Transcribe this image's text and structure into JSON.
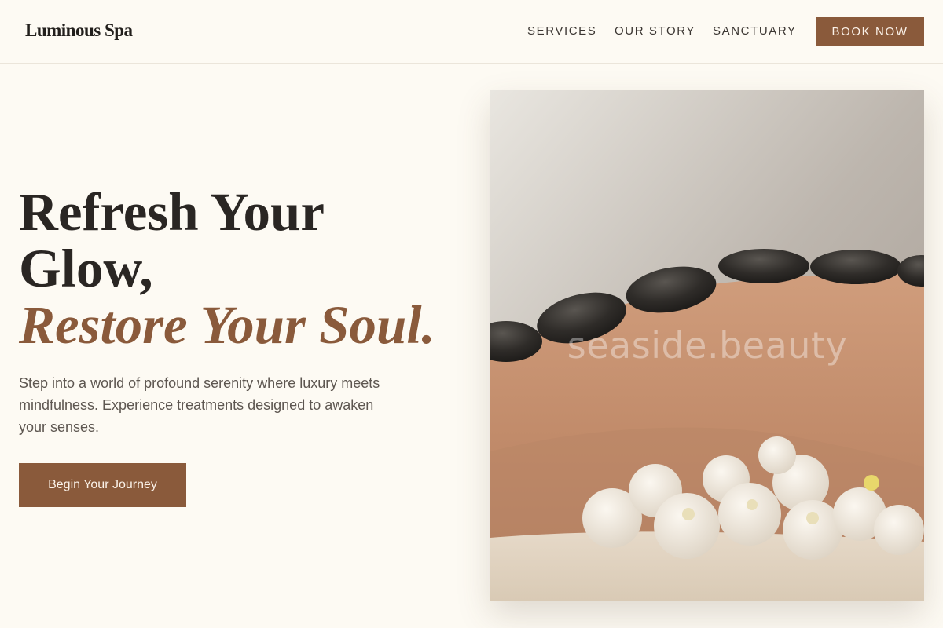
{
  "brand": {
    "name": "Luminous Spa"
  },
  "nav": {
    "items": [
      "SERVICES",
      "OUR STORY",
      "SANCTUARY"
    ],
    "cta_label": "BOOK NOW"
  },
  "hero": {
    "headline_line1": "Refresh Your",
    "headline_line2": "Glow,",
    "headline_accent": "Restore Your Soul.",
    "subtext": "Step into a world of profound serenity where luxury meets mindfulness. Experience treatments designed to awaken your senses.",
    "cta_label": "Begin Your Journey",
    "image_watermark": "seaside.beauty"
  },
  "colors": {
    "background": "#fdfaf3",
    "accent": "#8a5a3b",
    "text": "#2a2623"
  }
}
